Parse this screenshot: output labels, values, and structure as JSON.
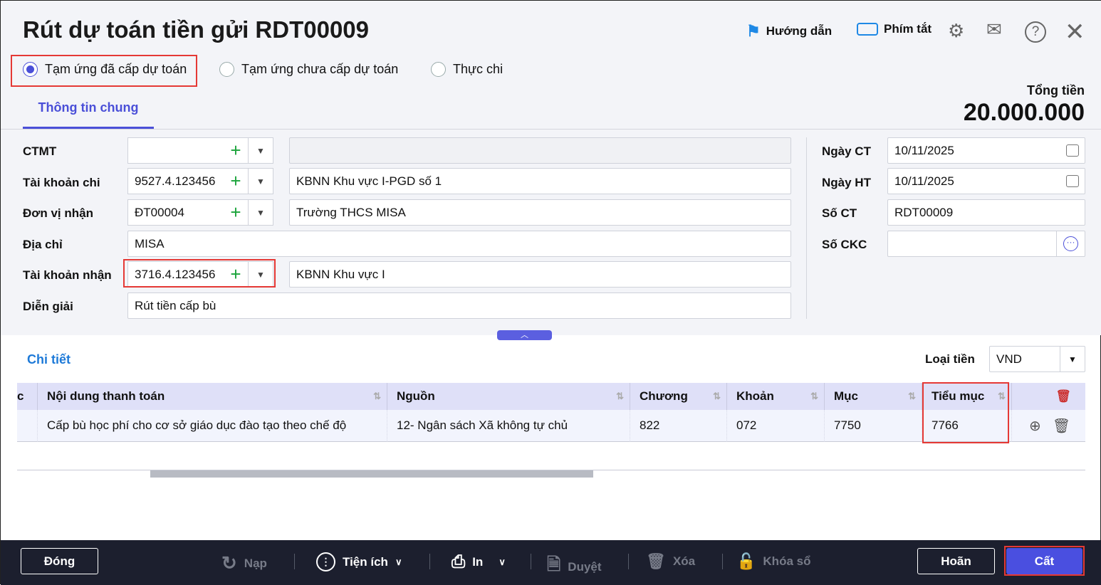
{
  "header": {
    "title": "Rút dự toán tiền gửi RDT00009",
    "guide": "Hướng dẫn",
    "shortcuts": "Phím tắt"
  },
  "radios": [
    {
      "label": "Tạm ứng đã cấp dự toán",
      "checked": true
    },
    {
      "label": "Tạm ứng chưa cấp dự toán",
      "checked": false
    },
    {
      "label": "Thực chi",
      "checked": false
    }
  ],
  "tabs": {
    "general": "Thông tin chung"
  },
  "total": {
    "label": "Tổng tiền",
    "value": "20.000.000"
  },
  "form": {
    "ctmt": {
      "label": "CTMT",
      "code": "",
      "name": ""
    },
    "tk_chi": {
      "label": "Tài khoản chi",
      "code": "9527.4.123456",
      "name": "KBNN Khu vực I-PGD số 1"
    },
    "don_vi": {
      "label": "Đơn vị nhận",
      "code": "ĐT00004",
      "name": "Trường THCS MISA"
    },
    "dia_chi": {
      "label": "Địa chỉ",
      "value": "MISA"
    },
    "tk_nhan": {
      "label": "Tài khoản nhận",
      "code": "3716.4.123456",
      "name": "KBNN Khu vực I"
    },
    "dien_giai": {
      "label": "Diễn giải",
      "value": "Rút tiền cấp bù"
    },
    "ngay_ct": {
      "label": "Ngày CT",
      "value": "10/11/2025"
    },
    "ngay_ht": {
      "label": "Ngày HT",
      "value": "10/11/2025"
    },
    "so_ct": {
      "label": "Số CT",
      "value": "RDT00009"
    },
    "so_ckc": {
      "label": "Số CKC",
      "value": ""
    }
  },
  "detail": {
    "title": "Chi tiết",
    "currency_label": "Loại tiền",
    "currency": "VND",
    "columns": [
      "c",
      "Nội dung thanh toán",
      "Nguồn",
      "Chương",
      "Khoản",
      "Mục",
      "Tiểu mục"
    ],
    "rows": [
      {
        "noi_dung": "Cấp bù học phí cho cơ sở giáo dục đào tạo theo chế độ",
        "nguon": "12- Ngân sách Xã không tự chủ",
        "chuong": "822",
        "khoan": "072",
        "muc": "7750",
        "tieu_muc": "7766"
      }
    ]
  },
  "footer": {
    "close": "Đóng",
    "reload": "Nạp",
    "utilities": "Tiện ích",
    "print": "In",
    "approve": "Duyệt",
    "delete": "Xóa",
    "lock": "Khóa sổ",
    "cancel": "Hoãn",
    "save": "Cất"
  }
}
